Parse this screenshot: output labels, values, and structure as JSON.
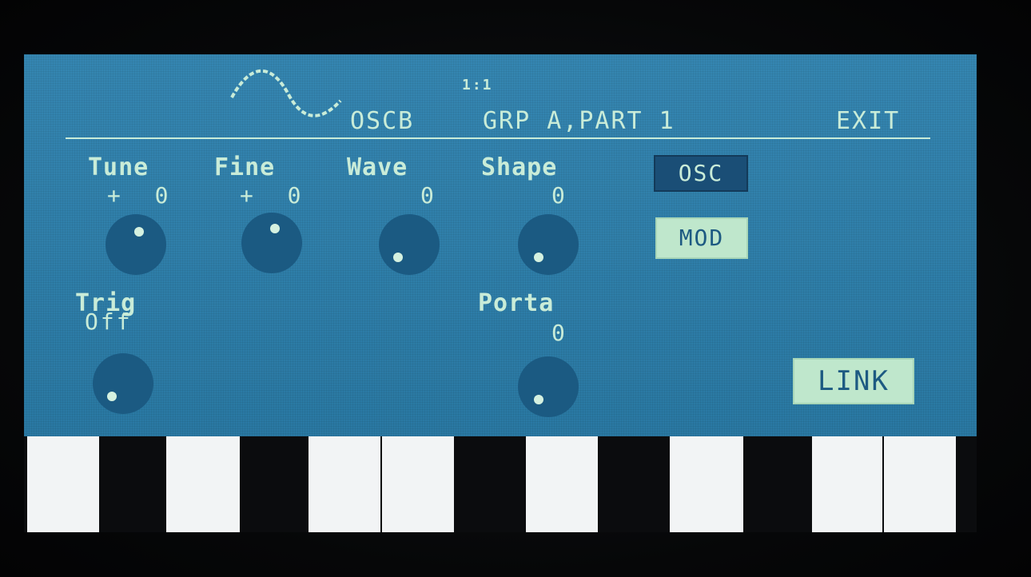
{
  "header": {
    "location": "1:1",
    "module": "OSCB",
    "group_part": "GRP A,PART 1",
    "exit_label": "EXIT",
    "waveform_icon": "sine-wave-icon"
  },
  "params": [
    {
      "label": "Tune",
      "value": "+  0"
    },
    {
      "label": "Fine",
      "value": "+  0"
    },
    {
      "label": "Wave",
      "value": "0"
    },
    {
      "label": "Shape",
      "value": "0"
    },
    {
      "label": "Trig",
      "value": "Off"
    },
    {
      "label": "Porta",
      "value": "0"
    }
  ],
  "buttons": {
    "osc": "OSC",
    "mod": "MOD",
    "link": "LINK"
  },
  "colors": {
    "lcd_background": "#2a7fad",
    "lcd_text": "#c9ecd8",
    "knob": "#1b5a82",
    "selected_button": "#1a4e76",
    "unselected_button": "#bfe7cc"
  }
}
